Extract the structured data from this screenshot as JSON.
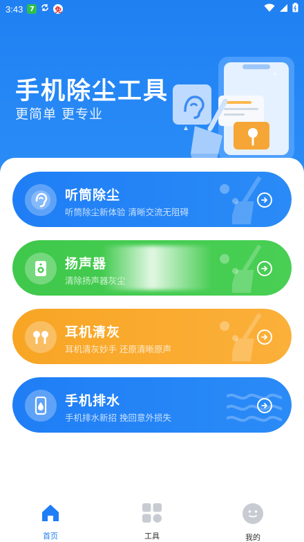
{
  "status_bar": {
    "time": "3:43",
    "badge_green": "7",
    "badge_red": "免"
  },
  "hero": {
    "title": "手机除尘工具",
    "subtitle": "更简单  更专业"
  },
  "cards": [
    {
      "title": "听筒除尘",
      "subtitle": "听筒除尘新体验 清晰交流无阻碍",
      "icon": "ear-icon",
      "color": "#1f7ef5"
    },
    {
      "title": "扬声器",
      "subtitle": "清除扬声器灰尘",
      "icon": "speaker-icon",
      "color": "#3fc84b"
    },
    {
      "title": "耳机清灰",
      "subtitle": "耳机清灰妙手 还原清晰原声",
      "icon": "earphones-icon",
      "color": "#f8a524"
    },
    {
      "title": "手机排水",
      "subtitle": "手机排水新招 挽回意外损失",
      "icon": "phone-water-icon",
      "color": "#1f7ef5"
    }
  ],
  "tabs": [
    {
      "label": "首页",
      "icon": "home-icon",
      "active": true,
      "color": "#1f7ef5"
    },
    {
      "label": "工具",
      "icon": "grid-icon",
      "active": false,
      "color": "#333333"
    },
    {
      "label": "我的",
      "icon": "smiley-icon",
      "active": false,
      "color": "#333333"
    }
  ]
}
